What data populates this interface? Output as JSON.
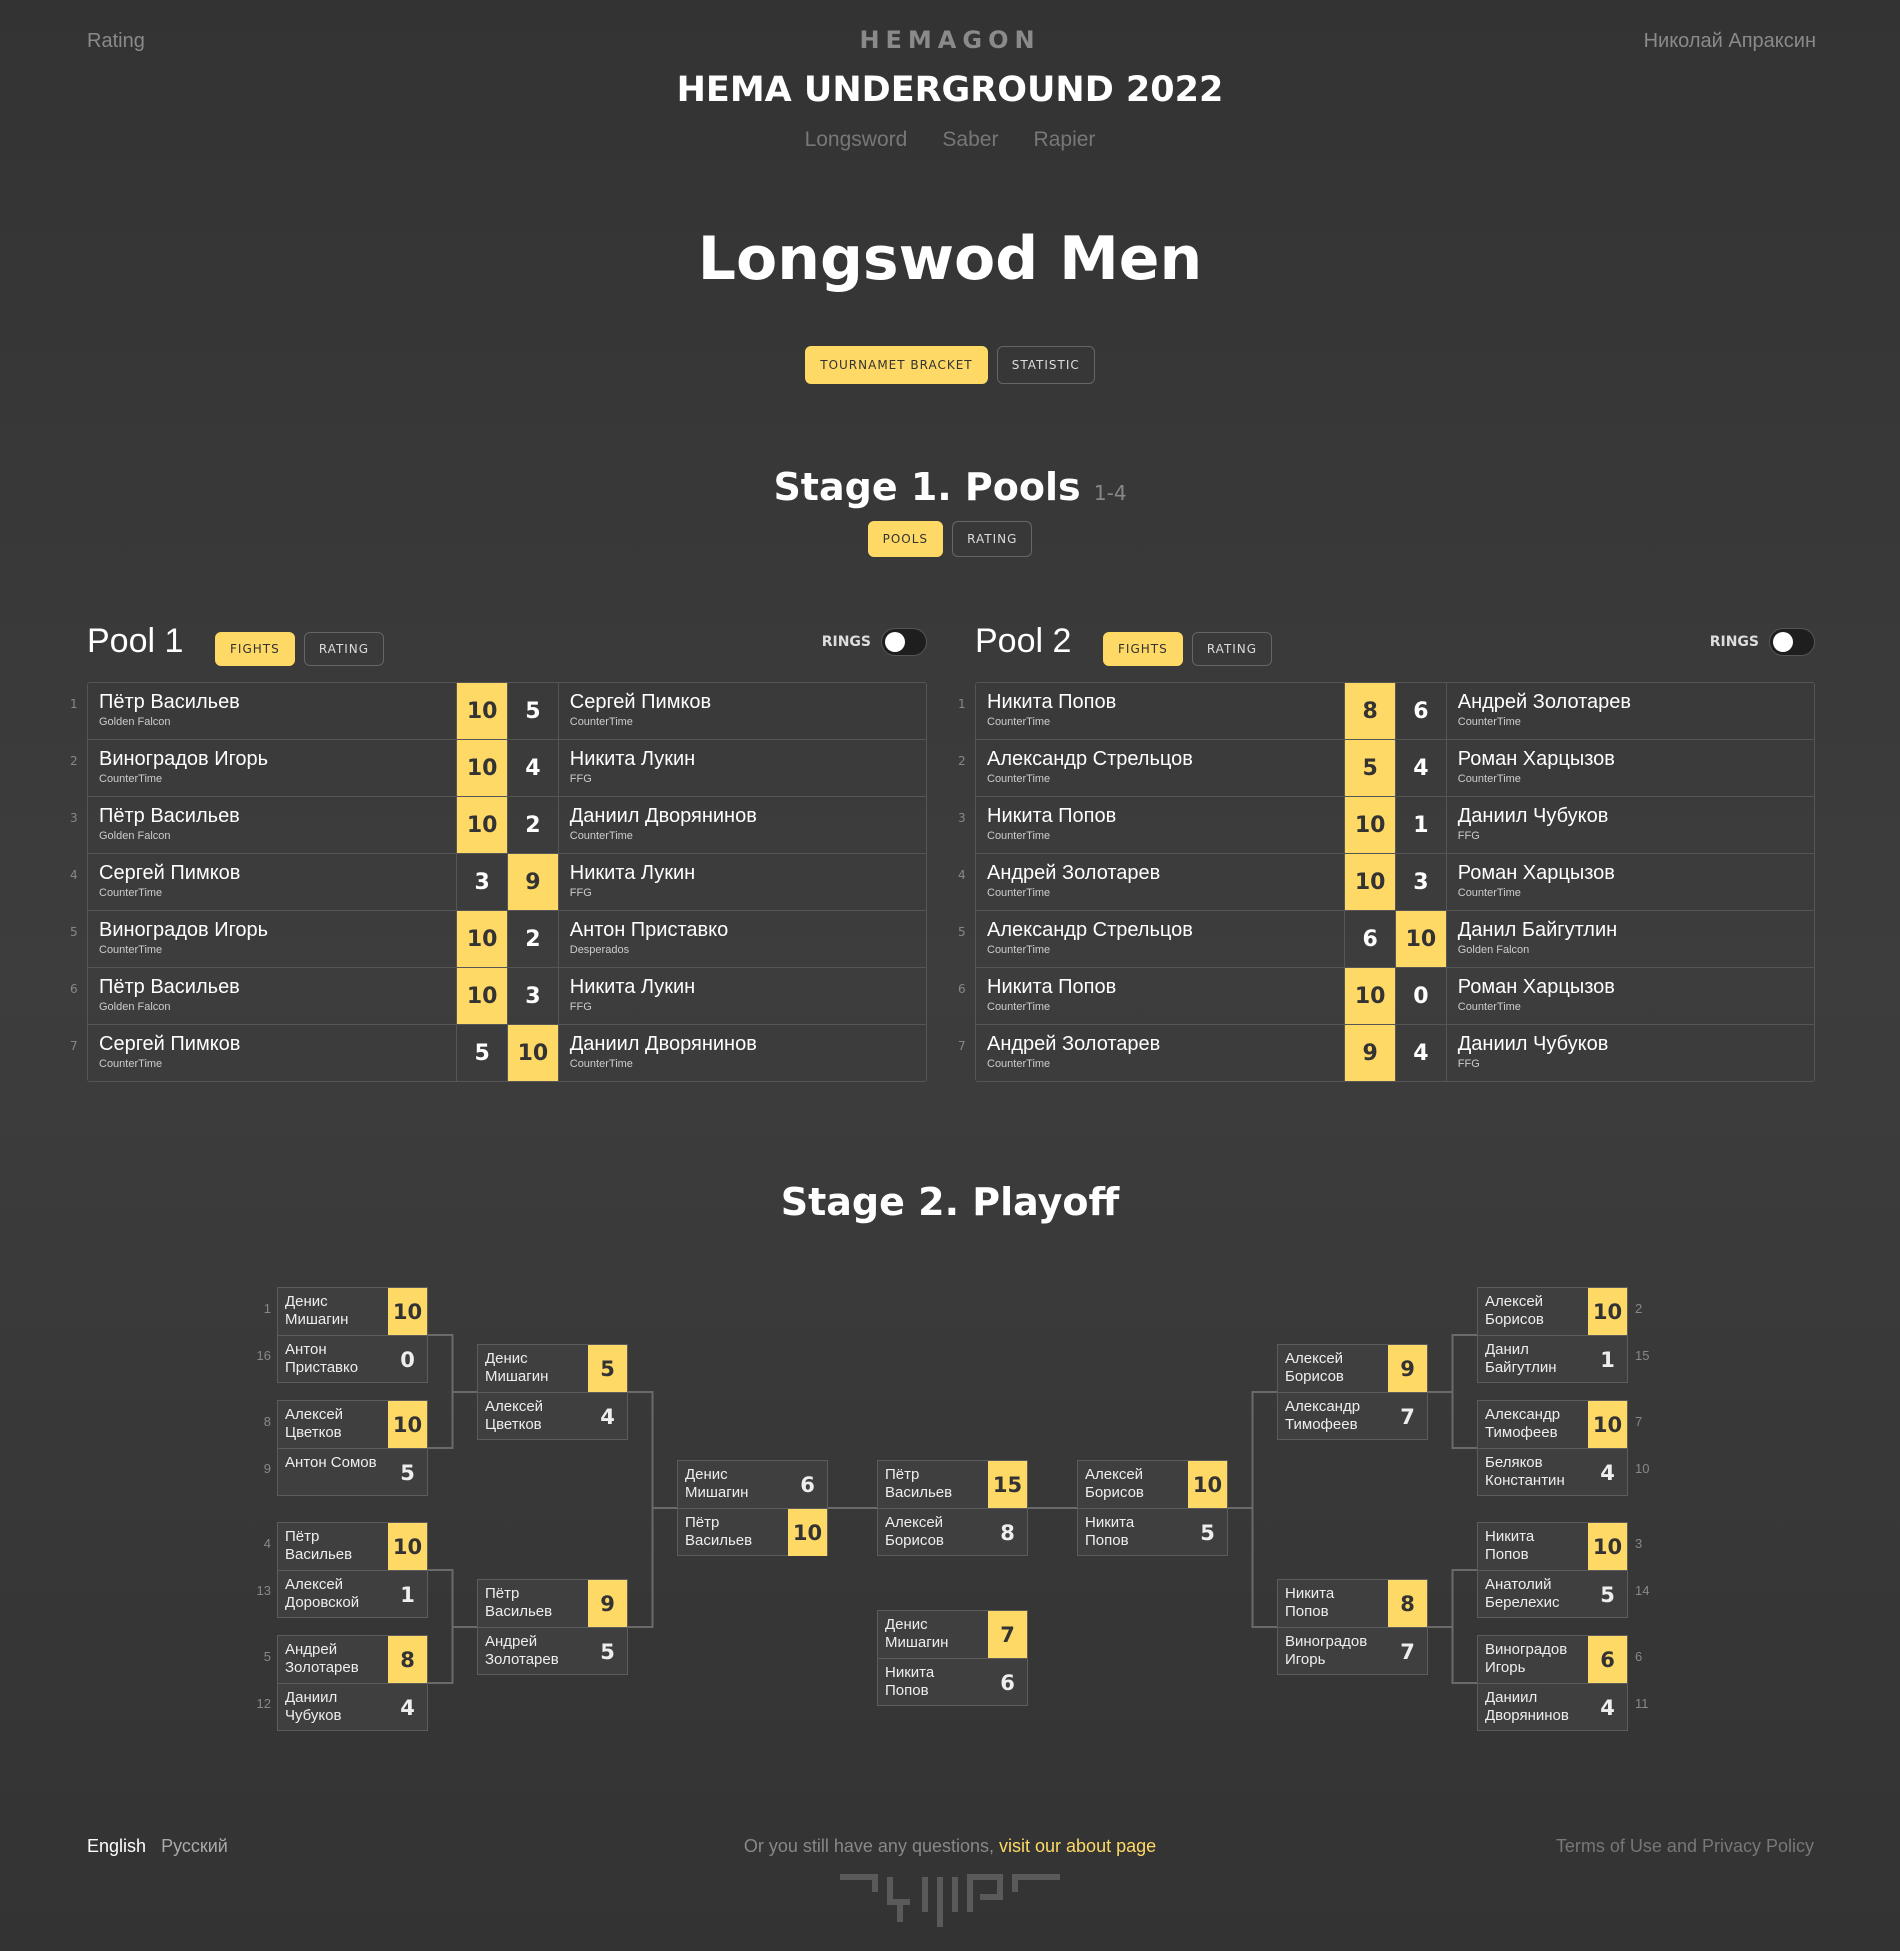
{
  "nav": {
    "rating": "Rating",
    "brand": "HEMAGON",
    "user": "Николай Апраксин"
  },
  "tournament": "HEMA UNDERGROUND 2022",
  "weapons": [
    "Longsword",
    "Saber",
    "Rapier"
  ],
  "event_title": "Longswod Men",
  "main_tabs": {
    "bracket": "TOURNAMET BRACKET",
    "statistic": "STATISTIC"
  },
  "stage1": {
    "title": "Stage 1. Pools",
    "range": "1-4",
    "tabs": {
      "pools": "POOLS",
      "rating": "RATING"
    }
  },
  "pool_tabs": {
    "fights": "FIGHTS",
    "rating": "RATING",
    "rings": "RINGS"
  },
  "pools": [
    {
      "name": "Pool 1",
      "fights": [
        {
          "n": "1",
          "a": "Пётр Васильев",
          "ac": "Golden Falcon",
          "as": "10",
          "b": "Сергей Пимков",
          "bc": "CounterTime",
          "bs": "5",
          "w": "a"
        },
        {
          "n": "2",
          "a": "Виноградов Игорь",
          "ac": "CounterTime",
          "as": "10",
          "b": "Никита Лукин",
          "bc": "FFG",
          "bs": "4",
          "w": "a"
        },
        {
          "n": "3",
          "a": "Пётр Васильев",
          "ac": "Golden Falcon",
          "as": "10",
          "b": "Даниил Дворянинов",
          "bc": "CounterTime",
          "bs": "2",
          "w": "a"
        },
        {
          "n": "4",
          "a": "Сергей Пимков",
          "ac": "CounterTime",
          "as": "3",
          "b": "Никита Лукин",
          "bc": "FFG",
          "bs": "9",
          "w": "b"
        },
        {
          "n": "5",
          "a": "Виноградов Игорь",
          "ac": "CounterTime",
          "as": "10",
          "b": "Антон Приставко",
          "bc": "Desperados",
          "bs": "2",
          "w": "a"
        },
        {
          "n": "6",
          "a": "Пётр Васильев",
          "ac": "Golden Falcon",
          "as": "10",
          "b": "Никита Лукин",
          "bc": "FFG",
          "bs": "3",
          "w": "a"
        },
        {
          "n": "7",
          "a": "Сергей Пимков",
          "ac": "CounterTime",
          "as": "5",
          "b": "Даниил Дворянинов",
          "bc": "CounterTime",
          "bs": "10",
          "w": "b"
        }
      ]
    },
    {
      "name": "Pool 2",
      "fights": [
        {
          "n": "1",
          "a": "Никита Попов",
          "ac": "CounterTime",
          "as": "8",
          "b": "Андрей Золотарев",
          "bc": "CounterTime",
          "bs": "6",
          "w": "a"
        },
        {
          "n": "2",
          "a": "Александр Стрельцов",
          "ac": "CounterTime",
          "as": "5",
          "b": "Роман Харцызов",
          "bc": "CounterTime",
          "bs": "4",
          "w": "a"
        },
        {
          "n": "3",
          "a": "Никита Попов",
          "ac": "CounterTime",
          "as": "10",
          "b": "Даниил Чубуков",
          "bc": "FFG",
          "bs": "1",
          "w": "a"
        },
        {
          "n": "4",
          "a": "Андрей Золотарев",
          "ac": "CounterTime",
          "as": "10",
          "b": "Роман Харцызов",
          "bc": "CounterTime",
          "bs": "3",
          "w": "a"
        },
        {
          "n": "5",
          "a": "Александр Стрельцов",
          "ac": "CounterTime",
          "as": "6",
          "b": "Данил Байгутлин",
          "bc": "Golden Falcon",
          "bs": "10",
          "w": "b"
        },
        {
          "n": "6",
          "a": "Никита Попов",
          "ac": "CounterTime",
          "as": "10",
          "b": "Роман Харцызов",
          "bc": "CounterTime",
          "bs": "0",
          "w": "a"
        },
        {
          "n": "7",
          "a": "Андрей Золотарев",
          "ac": "CounterTime",
          "as": "9",
          "b": "Даниил Чубуков",
          "bc": "FFG",
          "bs": "4",
          "w": "a"
        }
      ]
    }
  ],
  "stage2": {
    "title": "Stage 2. Playoff"
  },
  "playoff": [
    {
      "a": "Денис\nМишагин",
      "as": "10",
      "sa": "1",
      "b": "Антон\nПриставко",
      "bs": "0",
      "sb": "16",
      "w": "a"
    },
    {
      "a": "Алексей\nЦветков",
      "as": "10",
      "sa": "8",
      "b": "Антон Сомов",
      "bs": "5",
      "sb": "9",
      "w": "a"
    },
    {
      "a": "Пётр\nВасильев",
      "as": "10",
      "sa": "4",
      "b": "Алексей\nДоровской",
      "bs": "1",
      "sb": "13",
      "w": "a"
    },
    {
      "a": "Андрей\nЗолотарев",
      "as": "8",
      "sa": "5",
      "b": "Даниил\nЧубуков",
      "bs": "4",
      "sb": "12",
      "w": "a"
    },
    {
      "a": "Денис\nМишагин",
      "as": "5",
      "b": "Алексей\nЦветков",
      "bs": "4",
      "w": "a"
    },
    {
      "a": "Пётр\nВасильев",
      "as": "9",
      "b": "Андрей\nЗолотарев",
      "bs": "5",
      "w": "a"
    },
    {
      "a": "Денис\nМишагин",
      "as": "6",
      "b": "Пётр\nВасильев",
      "bs": "10",
      "w": "b"
    },
    {
      "a": "Пётр\nВасильев",
      "as": "15",
      "b": "Алексей\nБорисов",
      "bs": "8",
      "w": "a"
    },
    {
      "a": "Денис\nМишагин",
      "as": "7",
      "b": "Никита\nПопов",
      "bs": "6",
      "w": "a"
    },
    {
      "a": "Алексей\nБорисов",
      "as": "10",
      "b": "Никита\nПопов",
      "bs": "5",
      "w": "a"
    },
    {
      "a": "Алексей\nБорисов",
      "as": "9",
      "b": "Александр\nТимофеев",
      "bs": "7",
      "w": "a"
    },
    {
      "a": "Никита\nПопов",
      "as": "8",
      "b": "Виноградов\nИгорь",
      "bs": "7",
      "w": "a"
    },
    {
      "a": "Алексей\nБорисов",
      "as": "10",
      "sa": "2",
      "b": "Данил\nБайгутлин",
      "bs": "1",
      "sb": "15",
      "w": "a"
    },
    {
      "a": "Александр\nТимофеев",
      "as": "10",
      "sa": "7",
      "b": "Беляков\nКонстантин",
      "bs": "4",
      "sb": "10",
      "w": "a"
    },
    {
      "a": "Никита\nПопов",
      "as": "10",
      "sa": "3",
      "b": "Анатолий\nБерелехис",
      "bs": "5",
      "sb": "14",
      "w": "a"
    },
    {
      "a": "Виноградов\nИгорь",
      "as": "6",
      "sa": "6",
      "b": "Даниил\nДворянинов",
      "bs": "4",
      "sb": "11",
      "w": "a"
    }
  ],
  "footer": {
    "langs": [
      "English",
      "Русский"
    ],
    "question": "Or you still have any questions, ",
    "about_link": "visit our about page",
    "terms": "Terms of Use and Privacy Policy"
  },
  "colors": {
    "accent": "#ffd966",
    "background": "#3a3a3a"
  }
}
